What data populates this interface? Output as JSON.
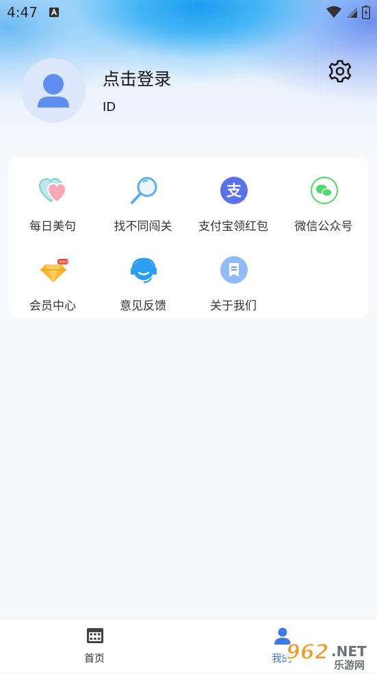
{
  "status_bar": {
    "time": "4:47",
    "icons": [
      "notification-a-icon",
      "wifi-icon",
      "signal-icon",
      "battery-icon"
    ]
  },
  "profile": {
    "login_label": "点击登录",
    "id_label": "ID",
    "avatar_icon": "user-avatar-icon",
    "settings_icon": "gear-icon"
  },
  "menu": {
    "items": [
      {
        "label": "每日美句",
        "icon": "hearts-icon",
        "color": "#8fd6d8"
      },
      {
        "label": "找不同闯关",
        "icon": "magnifier-icon",
        "color": "#5aaef0"
      },
      {
        "label": "支付宝领红包",
        "icon": "alipay-icon",
        "color": "#5a72e8"
      },
      {
        "label": "微信公众号",
        "icon": "wechat-icon",
        "color": "#4cd964"
      },
      {
        "label": "会员中心",
        "icon": "diamond-icon",
        "color": "#f7b733"
      },
      {
        "label": "意见反馈",
        "icon": "headset-icon",
        "color": "#2a9df4"
      },
      {
        "label": "关于我们",
        "icon": "bookmark-icon",
        "color": "#5b9cf2"
      }
    ],
    "vip_badge": "领会员"
  },
  "tabbar": {
    "tabs": [
      {
        "label": "首页",
        "icon": "calendar-grid-icon",
        "active": false
      },
      {
        "label": "我的",
        "icon": "person-icon",
        "active": true
      }
    ],
    "active_color": "#3a7be8"
  },
  "watermark": {
    "brand": "962",
    "suffix": ".NET",
    "caption": "乐游网"
  }
}
